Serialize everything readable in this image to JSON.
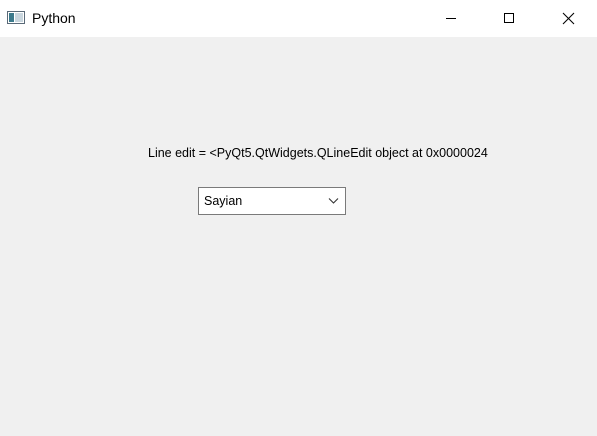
{
  "window": {
    "title": "Python",
    "icons": {
      "app": "python-window-icon",
      "minimize": "minimize-icon",
      "maximize": "maximize-icon",
      "close": "close-icon"
    }
  },
  "content": {
    "label_text": "Line edit = <PyQt5.QtWidgets.QLineEdit object at 0x0000024",
    "combo": {
      "selected": "Sayian",
      "arrow_icon": "chevron-down-icon"
    }
  },
  "colors": {
    "titlebar_bg": "#ffffff",
    "client_bg": "#f0f0f0",
    "combo_border": "#7a7a7a"
  }
}
